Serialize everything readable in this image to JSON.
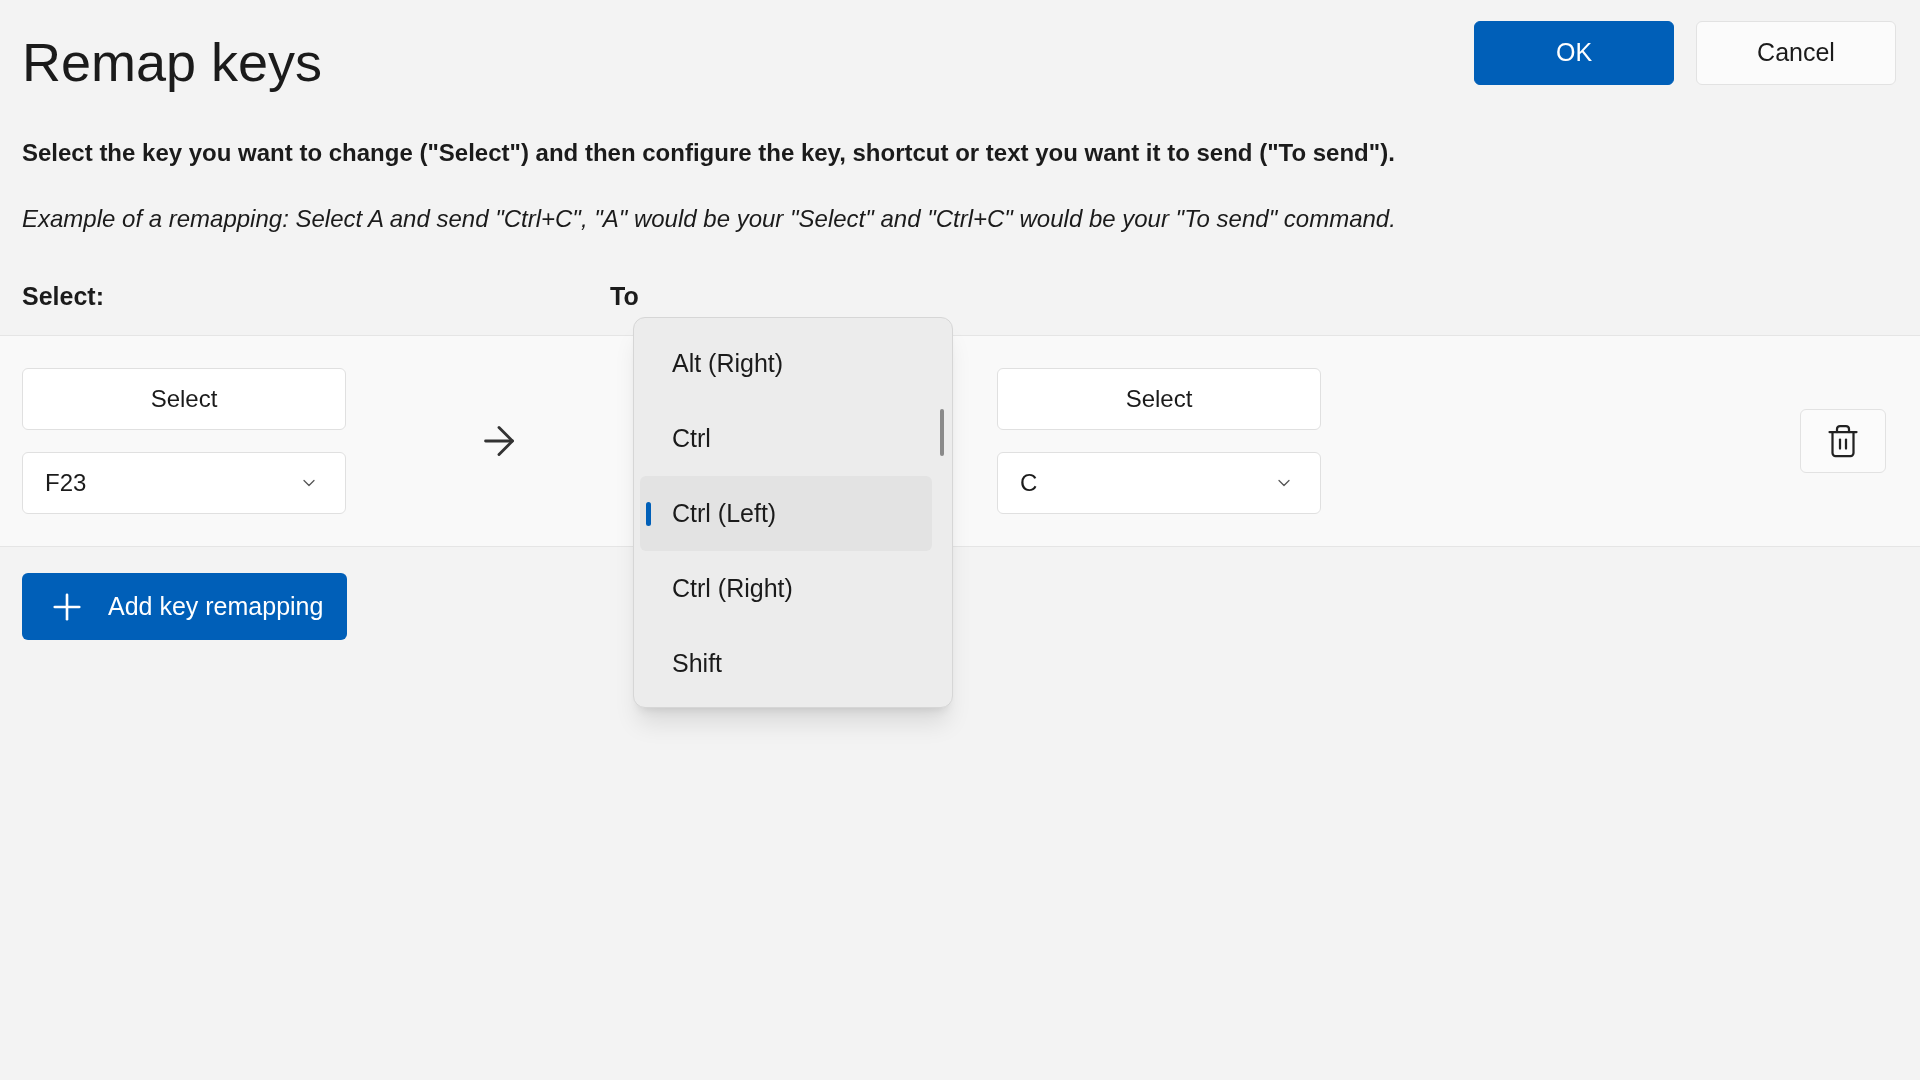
{
  "title": "Remap keys",
  "buttons": [
    {
      "label": "OK",
      "kind": "primary"
    },
    {
      "label": "Cancel",
      "kind": "secondary"
    }
  ],
  "description": "Select the key you want to change (\"Select\") and then configure the key, shortcut or text you want it to send (\"To send\").",
  "example": "Example of a remapping: Select A and send \"Ctrl+C\", \"A\" would be your \"Select\" and \"Ctrl+C\" would be your \"To send\" command.",
  "headers": [
    "Select:",
    "To"
  ],
  "mapping": {
    "select_button": "Select",
    "select_value": "F23",
    "send_button": "Select",
    "send_value": "C"
  },
  "add_button": "Add key remapping",
  "popup": {
    "items": [
      {
        "label": "Alt (Right)",
        "selected": false
      },
      {
        "label": "Ctrl",
        "selected": false
      },
      {
        "label": "Ctrl (Left)",
        "selected": true
      },
      {
        "label": "Ctrl (Right)",
        "selected": false
      },
      {
        "label": "Shift",
        "selected": false
      }
    ]
  }
}
